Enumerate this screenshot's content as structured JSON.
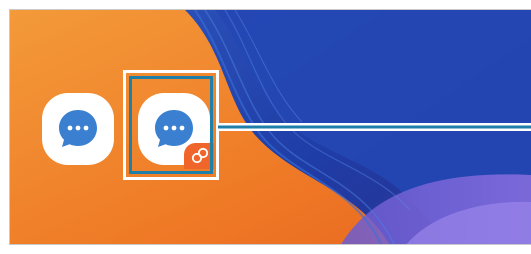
{
  "colors": {
    "accent_blue": "#1f7fa9",
    "icon_blue": "#3b7fd1",
    "badge_orange": "#f0662a",
    "wallpaper_orange": "#f08a2c",
    "wallpaper_blue": "#1e3fa8"
  },
  "home_screen": {
    "apps": [
      {
        "icon": "chat-bubble-icon"
      },
      {
        "icon": "chat-bubble-icon",
        "badge_icon": "dual-messenger-icon"
      }
    ]
  }
}
